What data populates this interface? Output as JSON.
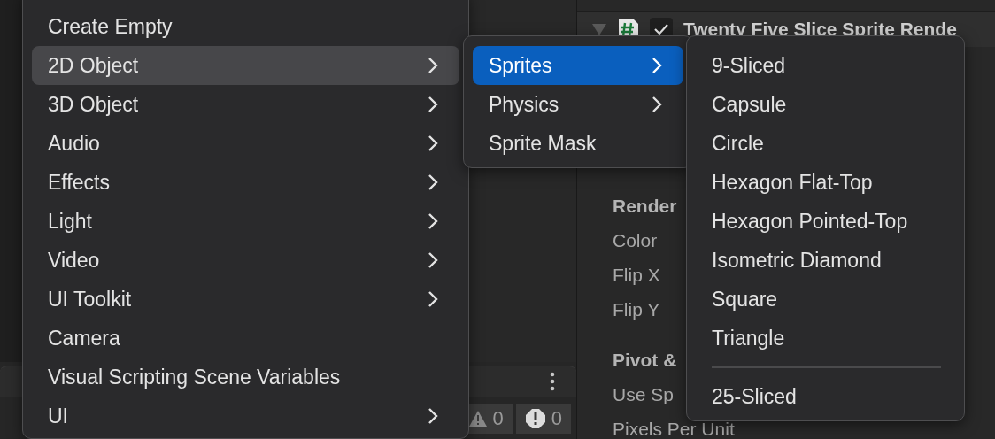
{
  "main_menu": {
    "items": [
      {
        "label": "Create Empty",
        "submenu": false,
        "selected": false
      },
      {
        "label": "2D Object",
        "submenu": true,
        "selected": true
      },
      {
        "label": "3D Object",
        "submenu": true,
        "selected": false
      },
      {
        "label": "Audio",
        "submenu": true,
        "selected": false
      },
      {
        "label": "Effects",
        "submenu": true,
        "selected": false
      },
      {
        "label": "Light",
        "submenu": true,
        "selected": false
      },
      {
        "label": "Video",
        "submenu": true,
        "selected": false
      },
      {
        "label": "UI Toolkit",
        "submenu": true,
        "selected": false
      },
      {
        "label": "Camera",
        "submenu": false,
        "selected": false
      },
      {
        "label": "Visual Scripting Scene Variables",
        "submenu": false,
        "selected": false
      },
      {
        "label": "UI",
        "submenu": true,
        "selected": false
      }
    ]
  },
  "object_2d_menu": {
    "items": [
      {
        "label": "Sprites",
        "submenu": true,
        "selected": true
      },
      {
        "label": "Physics",
        "submenu": true,
        "selected": false
      },
      {
        "label": "Sprite Mask",
        "submenu": false,
        "selected": false
      }
    ]
  },
  "sprites_menu": {
    "items": [
      {
        "kind": "item",
        "label": "9-Sliced"
      },
      {
        "kind": "item",
        "label": "Capsule"
      },
      {
        "kind": "item",
        "label": "Circle"
      },
      {
        "kind": "item",
        "label": "Hexagon Flat-Top"
      },
      {
        "kind": "item",
        "label": "Hexagon Pointed-Top"
      },
      {
        "kind": "item",
        "label": "Isometric Diamond"
      },
      {
        "kind": "item",
        "label": "Square"
      },
      {
        "kind": "item",
        "label": "Triangle"
      },
      {
        "kind": "separator"
      },
      {
        "kind": "item",
        "label": "25-Sliced"
      }
    ]
  },
  "inspector": {
    "component": {
      "title": "Twenty Five Slice Sprite Rende",
      "expanded": true,
      "enabled": true
    },
    "fields": [
      {
        "kind": "heading",
        "label": "Render"
      },
      {
        "kind": "field",
        "label": "Color"
      },
      {
        "kind": "field",
        "label": "Flip X"
      },
      {
        "kind": "field",
        "label": "Flip Y"
      },
      {
        "kind": "heading",
        "label": "Pivot &"
      },
      {
        "kind": "field",
        "label": "Use Sp"
      },
      {
        "kind": "field",
        "label": "Pixels Per Unit"
      }
    ]
  },
  "console": {
    "warnings": "0",
    "errors": "0"
  }
}
